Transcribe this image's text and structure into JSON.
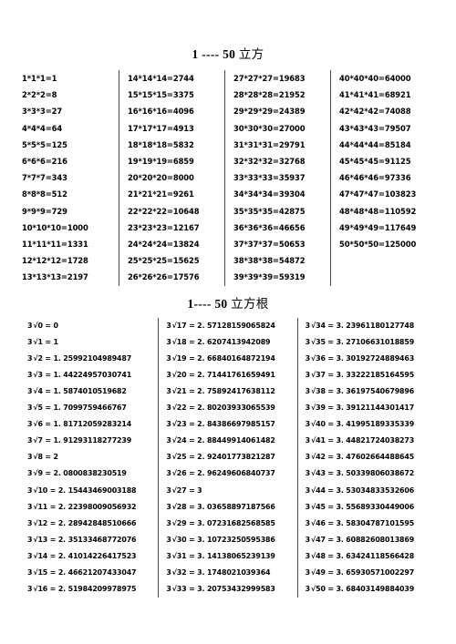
{
  "document": {
    "cube_section": {
      "title_range": "1 ---- 50",
      "title_label": "立方",
      "columns": [
        {
          "cells": [
            "1*1*1=1",
            "2*2*2=8",
            "3*3*3=27",
            "4*4*4=64",
            "5*5*5=125",
            "6*6*6=216",
            "7*7*7=343",
            "8*8*8=512",
            "9*9*9=729",
            "10*10*10=1000",
            "11*11*11=1331",
            "12*12*12=1728",
            "13*13*13=2197"
          ]
        },
        {
          "cells": [
            "14*14*14=2744",
            "15*15*15=3375",
            "16*16*16=4096",
            "17*17*17=4913",
            "18*18*18=5832",
            "19*19*19=6859",
            "20*20*20=8000",
            "21*21*21=9261",
            "22*22*22=10648",
            "23*23*23=12167",
            "24*24*24=13824",
            "25*25*25=15625",
            "26*26*26=17576"
          ]
        },
        {
          "cells": [
            "27*27*27=19683",
            "28*28*28=21952",
            "29*29*29=24389",
            "30*30*30=27000",
            "31*31*31=29791",
            "32*32*32=32768",
            "33*33*33=35937",
            "34*34*34=39304",
            "35*35*35=42875",
            "36*36*36=46656",
            "37*37*37=50653",
            "38*38*38=54872",
            "39*39*39=59319"
          ]
        },
        {
          "cells": [
            "40*40*40=64000",
            "41*41*41=68921",
            "42*42*42=74088",
            "43*43*43=79507",
            "44*44*44=85184",
            "45*45*45=91125",
            "46*46*46=97336",
            "47*47*47=103823",
            "48*48*48=110592",
            "49*49*49=117649",
            "50*50*50=125000",
            "",
            ""
          ]
        }
      ]
    },
    "cube_root_section": {
      "title_range": "1---- 50",
      "title_label": "立方根",
      "radical_prefix": "3",
      "radical_symbol": "√",
      "columns": [
        {
          "cells": [
            {
              "radicand": "0",
              "value": "0"
            },
            {
              "radicand": "1",
              "value": "1"
            },
            {
              "radicand": "2",
              "value": "1. 25992104989487"
            },
            {
              "radicand": "3",
              "value": "1. 44224957030741"
            },
            {
              "radicand": "4",
              "value": "1. 5874010519682"
            },
            {
              "radicand": "5",
              "value": "1. 7099759466767"
            },
            {
              "radicand": "6",
              "value": "1. 81712059283214"
            },
            {
              "radicand": "7",
              "value": "1. 91293118277239"
            },
            {
              "radicand": "8",
              "value": "2"
            },
            {
              "radicand": "9",
              "value": "2. 0800838230519"
            },
            {
              "radicand": "10",
              "value": "2. 15443469003188"
            },
            {
              "radicand": "11",
              "value": "2. 22398009056932"
            },
            {
              "radicand": "12",
              "value": "2. 28942848510666"
            },
            {
              "radicand": "13",
              "value": "2. 35133468772076"
            },
            {
              "radicand": "14",
              "value": "2. 41014226417523"
            },
            {
              "radicand": "15",
              "value": "2. 46621207433047"
            },
            {
              "radicand": "16",
              "value": "2. 51984209978975"
            }
          ]
        },
        {
          "cells": [
            {
              "radicand": "17",
              "value": "2. 57128159065824"
            },
            {
              "radicand": "18",
              "value": "2. 6207413942089"
            },
            {
              "radicand": "19",
              "value": "2. 66840164872194"
            },
            {
              "radicand": "20",
              "value": "2. 71441761659491"
            },
            {
              "radicand": "21",
              "value": "2. 75892417638112"
            },
            {
              "radicand": "22",
              "value": "2. 80203933065539"
            },
            {
              "radicand": "23",
              "value": "2. 84386697985157"
            },
            {
              "radicand": "24",
              "value": "2. 88449914061482"
            },
            {
              "radicand": "25",
              "value": "2. 92401773821287"
            },
            {
              "radicand": "26",
              "value": "2. 96249606840737"
            },
            {
              "radicand": "27",
              "value": "3"
            },
            {
              "radicand": "28",
              "value": "3. 03658897187566"
            },
            {
              "radicand": "29",
              "value": "3. 07231682568585"
            },
            {
              "radicand": "30",
              "value": "3. 10723250595386"
            },
            {
              "radicand": "31",
              "value": "3. 14138065239139"
            },
            {
              "radicand": "32",
              "value": "3. 1748021039364"
            },
            {
              "radicand": "33",
              "value": "3. 20753432999583"
            }
          ]
        },
        {
          "cells": [
            {
              "radicand": "34",
              "value": "3. 23961180127748"
            },
            {
              "radicand": "35",
              "value": "3. 27106631018859"
            },
            {
              "radicand": "36",
              "value": "3. 30192724889463"
            },
            {
              "radicand": "37",
              "value": "3. 33222185164595"
            },
            {
              "radicand": "38",
              "value": "3. 36197540679896"
            },
            {
              "radicand": "39",
              "value": "3. 39121144301417"
            },
            {
              "radicand": "40",
              "value": "3. 41995189335339"
            },
            {
              "radicand": "41",
              "value": "3. 44821724038273"
            },
            {
              "radicand": "42",
              "value": "3. 47602664488645"
            },
            {
              "radicand": "43",
              "value": "3. 50339806038672"
            },
            {
              "radicand": "44",
              "value": "3. 53034833532606"
            },
            {
              "radicand": "45",
              "value": "3. 55689330449006"
            },
            {
              "radicand": "46",
              "value": "3. 58304787101595"
            },
            {
              "radicand": "47",
              "value": "3. 60882608013869"
            },
            {
              "radicand": "48",
              "value": "3. 63424118566428"
            },
            {
              "radicand": "49",
              "value": "3. 65930571002297"
            },
            {
              "radicand": "50",
              "value": "3. 68403149884039"
            }
          ]
        }
      ]
    }
  }
}
